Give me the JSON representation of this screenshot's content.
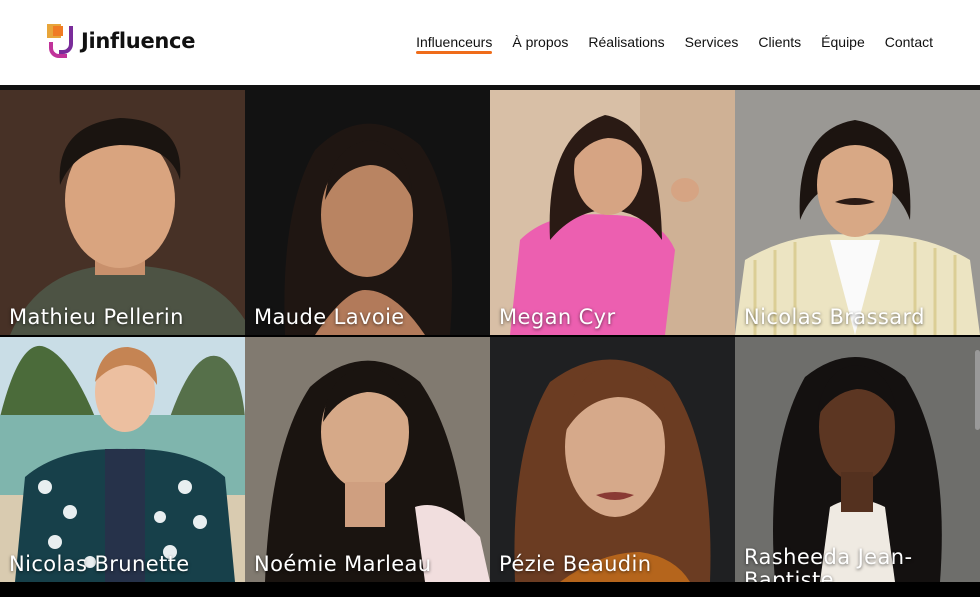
{
  "brand": {
    "name": "Jinfluence"
  },
  "nav": {
    "items": [
      {
        "label": "Influenceurs",
        "active": true
      },
      {
        "label": "À propos",
        "active": false
      },
      {
        "label": "Réalisations",
        "active": false
      },
      {
        "label": "Services",
        "active": false
      },
      {
        "label": "Clients",
        "active": false
      },
      {
        "label": "Équipe",
        "active": false
      },
      {
        "label": "Contact",
        "active": false
      }
    ]
  },
  "colors": {
    "accent": "#ef6c1a",
    "logo_purple": "#7a2c9a",
    "logo_orange": "#e8a53a"
  },
  "influencers": [
    {
      "name": "Mathieu Pellerin"
    },
    {
      "name": "Maude Lavoie"
    },
    {
      "name": "Megan Cyr"
    },
    {
      "name": "Nicolas Brassard"
    },
    {
      "name": "Nicolas Brunette"
    },
    {
      "name": "Noémie Marleau"
    },
    {
      "name": "Pézie Beaudin"
    },
    {
      "name": "Rasheeda Jean-Baptiste"
    }
  ]
}
